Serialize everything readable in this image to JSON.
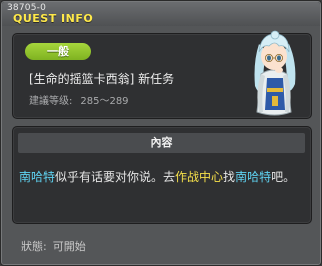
{
  "window": {
    "quest_id": "38705-0",
    "title": "QUEST INFO"
  },
  "header": {
    "category": "一般",
    "quest_name": "[生命的摇篮卡西翁] 新任务",
    "level_label": "建議等级:",
    "level_range": "285～289"
  },
  "content": {
    "header": "內容",
    "desc_npc1": "南哈特",
    "desc_text1": "似乎有话要对你说。去",
    "desc_place": "作战中心",
    "desc_text2": "找",
    "desc_npc2": "南哈特",
    "desc_text3": "吧。"
  },
  "status": {
    "label": "狀態:",
    "value": "可開始"
  },
  "colors": {
    "npc_link": "#5fd3f2",
    "place_link": "#f5e04a",
    "title": "#ffe94a",
    "badge": "#8fc22c"
  },
  "icons": {
    "npc_portrait": "npc-portrait"
  }
}
